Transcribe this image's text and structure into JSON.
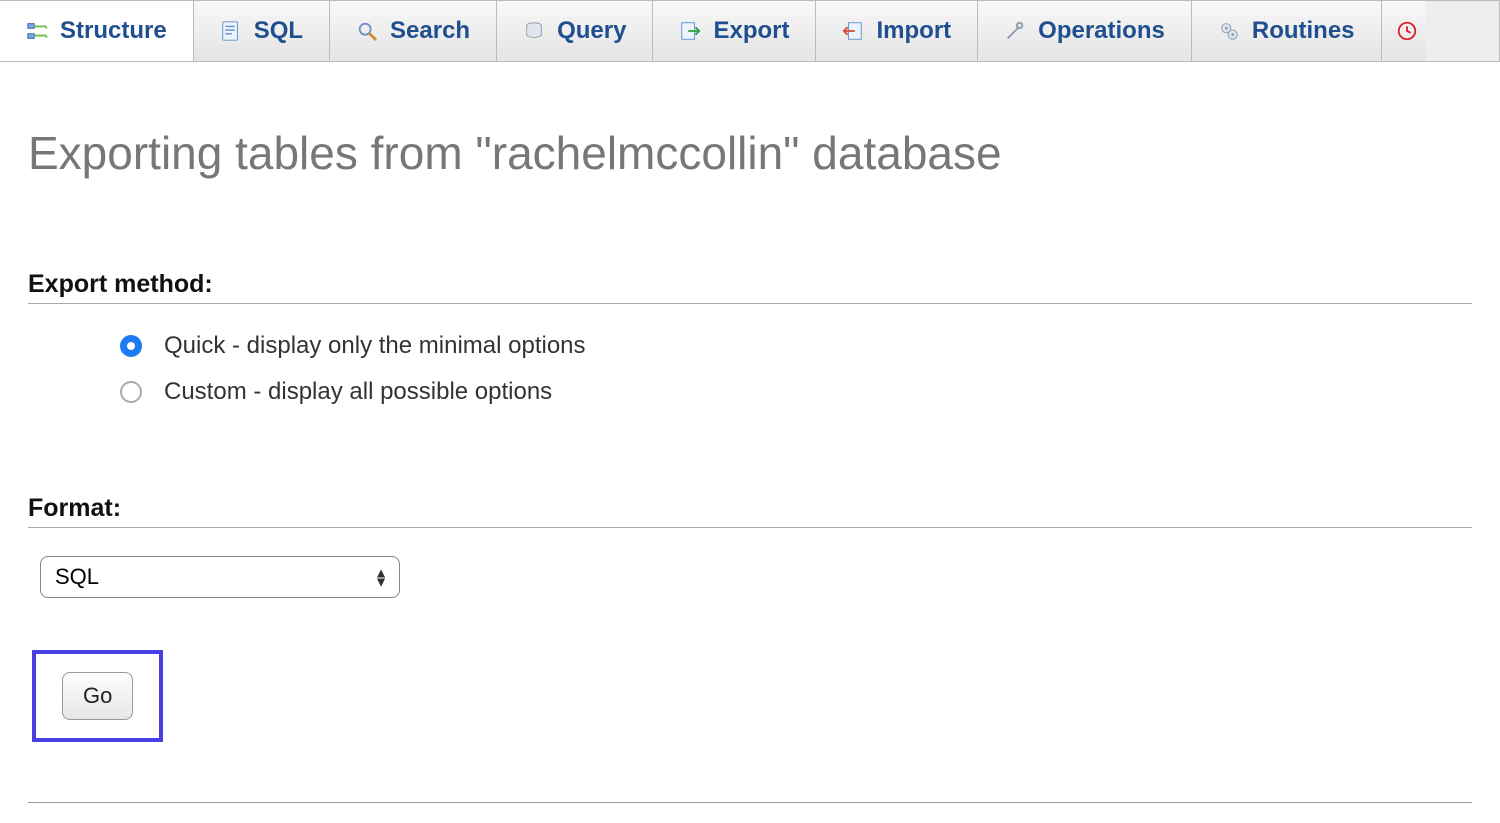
{
  "tabs": [
    {
      "id": "structure",
      "label": "Structure",
      "icon": "structure-icon",
      "active": true
    },
    {
      "id": "sql",
      "label": "SQL",
      "icon": "sql-icon",
      "active": false
    },
    {
      "id": "search",
      "label": "Search",
      "icon": "search-icon",
      "active": false
    },
    {
      "id": "query",
      "label": "Query",
      "icon": "query-icon",
      "active": false
    },
    {
      "id": "export",
      "label": "Export",
      "icon": "export-icon",
      "active": false
    },
    {
      "id": "import",
      "label": "Import",
      "icon": "import-icon",
      "active": false
    },
    {
      "id": "operations",
      "label": "Operations",
      "icon": "operations-icon",
      "active": false
    },
    {
      "id": "routines",
      "label": "Routines",
      "icon": "routines-icon",
      "active": false
    }
  ],
  "page_title": "Exporting tables from \"rachelmccollin\" database",
  "export_method": {
    "heading": "Export method:",
    "options": [
      {
        "id": "quick",
        "label": "Quick - display only the minimal options",
        "checked": true
      },
      {
        "id": "custom",
        "label": "Custom - display all possible options",
        "checked": false
      }
    ]
  },
  "format": {
    "heading": "Format:",
    "selected": "SQL"
  },
  "go_button_label": "Go"
}
